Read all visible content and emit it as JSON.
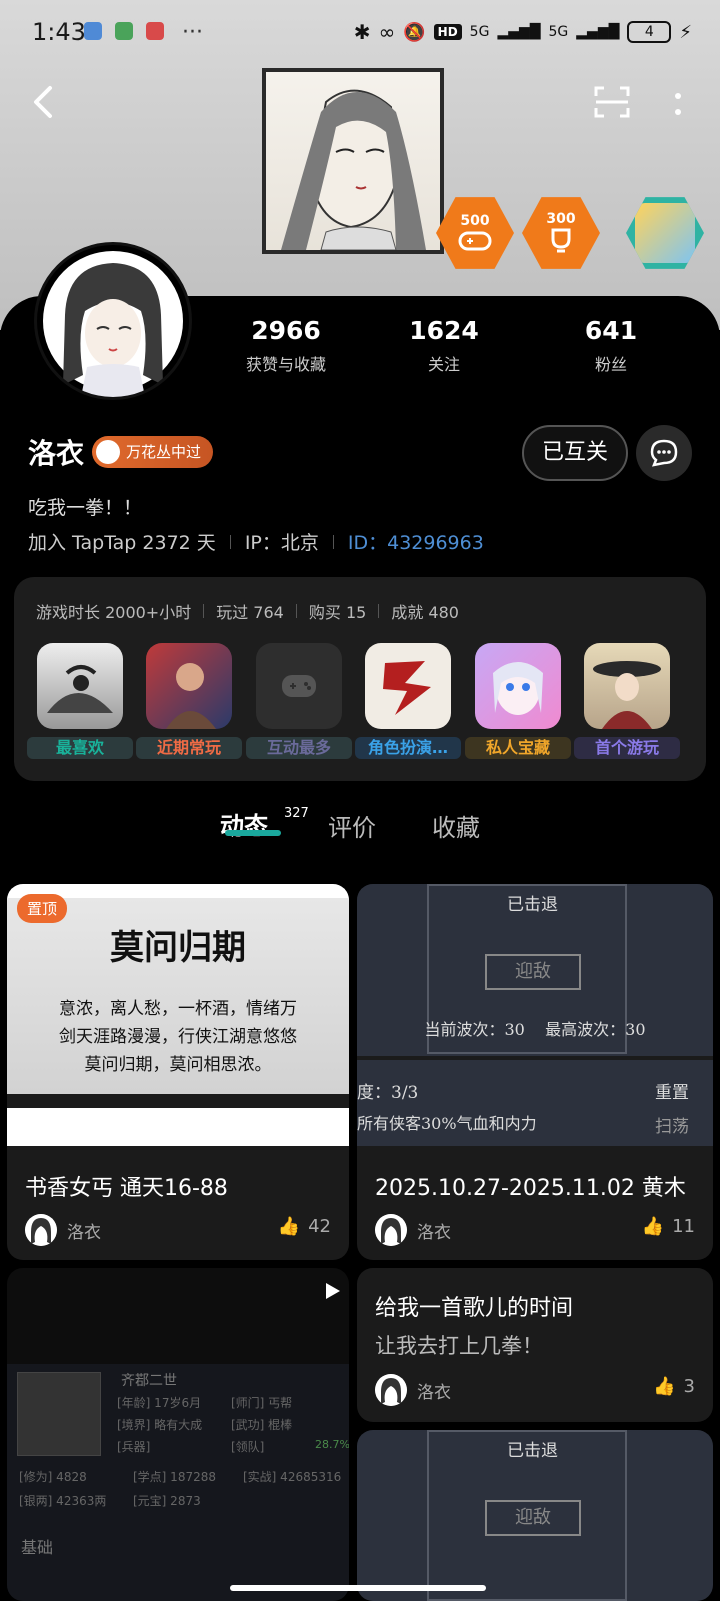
{
  "status_bar": {
    "time": "1:43",
    "more": "···",
    "network1": "5G",
    "network2": "5G",
    "hd": "HD",
    "battery": "4"
  },
  "header": {
    "back_icon": "back-arrow-icon",
    "scan_icon": "scan-icon",
    "more_icon": "more-vertical-icon"
  },
  "badges": [
    {
      "label": "500",
      "color": "#f07a1a"
    },
    {
      "label": "300",
      "color": "#f07a1a"
    }
  ],
  "profile": {
    "stats": [
      {
        "value": "2966",
        "label": "获赞与收藏"
      },
      {
        "value": "1624",
        "label": "关注"
      },
      {
        "value": "641",
        "label": "粉丝"
      }
    ],
    "name": "洛衣",
    "title_badge": "万花丛中过",
    "follow_label": "已互关",
    "bio": "吃我一拳！！",
    "joined": "加入 TapTap 2372 天",
    "ip": "IP：北京",
    "id": "ID：43296963"
  },
  "game_panel": {
    "stats": [
      "游戏时长 2000+小时",
      "玩过 764",
      "购买 15",
      "成就 480"
    ],
    "games": [
      {
        "label": "最喜欢",
        "color": "#19b29a"
      },
      {
        "label": "近期常玩",
        "color": "#f06b45"
      },
      {
        "label": "互动最多",
        "color": "#6a6a9a"
      },
      {
        "label": "角色扮演…",
        "color": "#3aa2e8"
      },
      {
        "label": "私人宝藏",
        "color": "#f0a62a"
      },
      {
        "label": "首个游玩",
        "color": "#8a7ae8"
      }
    ]
  },
  "tabs": [
    {
      "label": "动态",
      "count": "327"
    },
    {
      "label": "评价"
    },
    {
      "label": "收藏"
    }
  ],
  "feed": {
    "pinned_label": "置顶",
    "cards": [
      {
        "title": "书香女丐 通天16-88",
        "author": "洛衣",
        "likes": "42",
        "image_text_title": "莫问归期",
        "image_text_lines": [
          "意浓，离人愁，一杯酒，情绪万",
          "剑天涯路漫漫，行侠江湖意悠悠",
          "莫问归期，莫问相思浓。"
        ]
      },
      {
        "title": "2025.10.27-2025.11.02 黄木",
        "author": "洛衣",
        "likes": "11",
        "image_texts": [
          "已击退",
          "迎敌",
          "当前波次：30    最高波次：30",
          "度：3/3",
          "重置",
          "所有侠客30%气血和内力",
          "扫荡"
        ]
      },
      {
        "title": "给我一首歌儿的时间",
        "subtitle": "让我去打上几拳！",
        "author": "洛衣",
        "likes": "3"
      },
      {
        "image_texts": [
          "齐鄀二世",
          "[年龄] 17岁6月",
          "[师门] 丐帮",
          "[境界] 略有大成",
          "[武功] 棍棒",
          "[兵器]",
          "[领队]",
          "28.7%",
          "[修为] 4828",
          "[学点] 187288",
          "[实战] 42685316",
          "[银两] 42363两",
          "[元宝] 2873",
          "基础"
        ]
      },
      {
        "image_texts": [
          "已击退",
          "迎敌"
        ]
      }
    ]
  }
}
